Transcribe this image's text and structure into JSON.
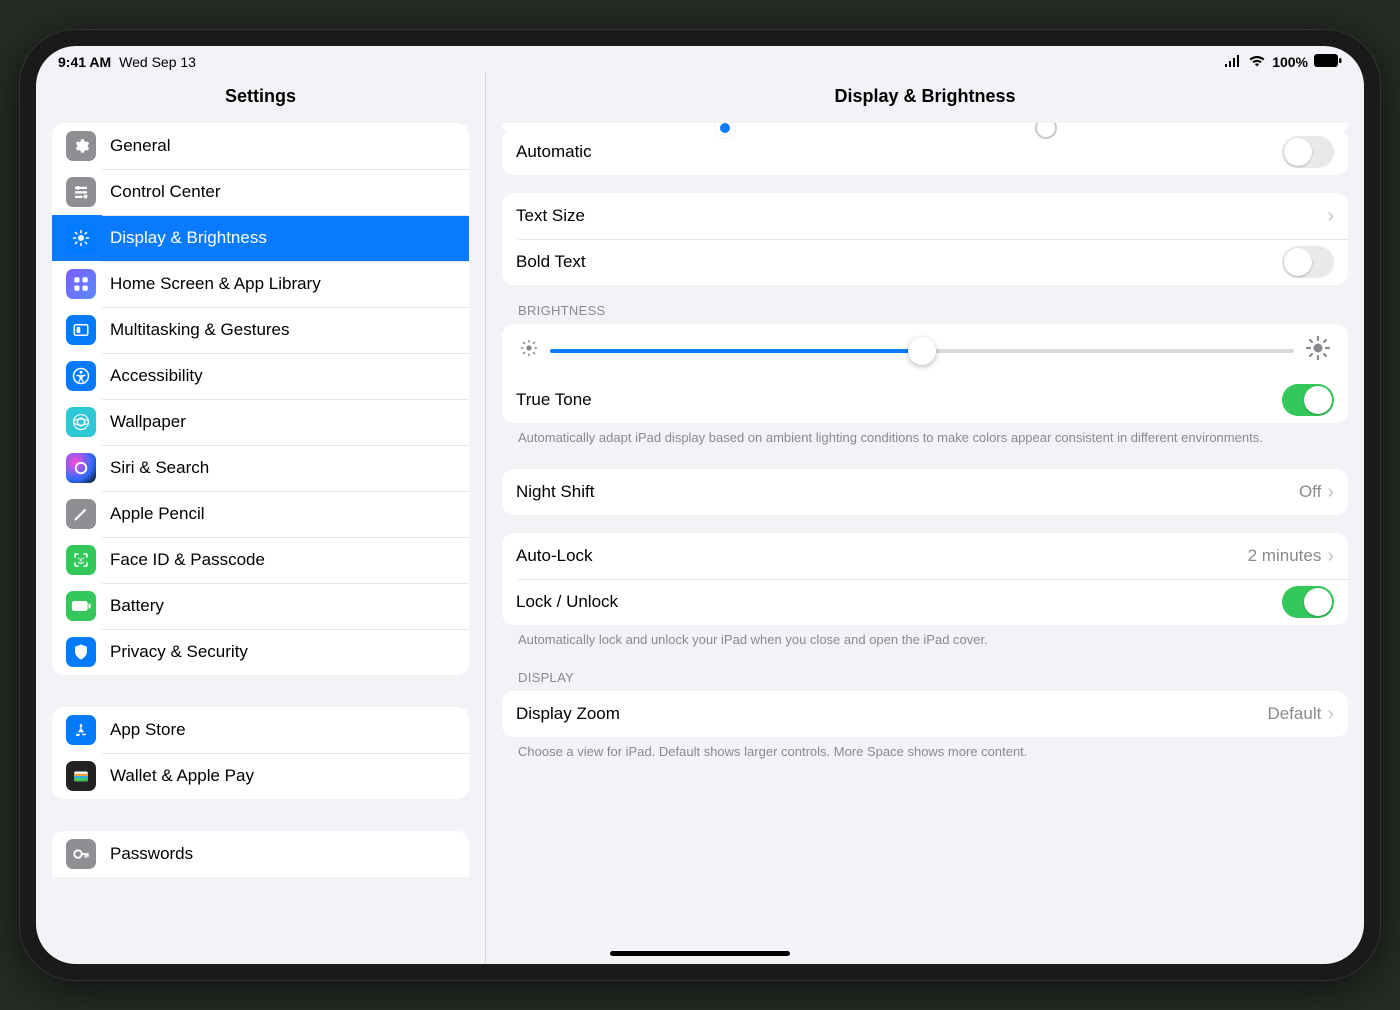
{
  "status": {
    "time": "9:41 AM",
    "date": "Wed Sep 13",
    "battery_pct": "100%"
  },
  "sidebar_title": "Settings",
  "detail_title": "Display & Brightness",
  "sidebar": {
    "group1": [
      {
        "key": "general",
        "label": "General",
        "iconColor": "bg-gray"
      },
      {
        "key": "control-center",
        "label": "Control Center",
        "iconColor": "bg-gray"
      },
      {
        "key": "display-brightness",
        "label": "Display & Brightness",
        "iconColor": "bg-blue",
        "selected": true
      },
      {
        "key": "home-screen",
        "label": "Home Screen & App Library",
        "iconColor": "bg-home"
      },
      {
        "key": "multitasking",
        "label": "Multitasking & Gestures",
        "iconColor": "bg-blue"
      },
      {
        "key": "accessibility",
        "label": "Accessibility",
        "iconColor": "bg-blue"
      },
      {
        "key": "wallpaper",
        "label": "Wallpaper",
        "iconColor": "bg-cyan"
      },
      {
        "key": "siri-search",
        "label": "Siri & Search",
        "iconColor": "bg-siri"
      },
      {
        "key": "apple-pencil",
        "label": "Apple Pencil",
        "iconColor": "bg-gray"
      },
      {
        "key": "faceid",
        "label": "Face ID & Passcode",
        "iconColor": "bg-green"
      },
      {
        "key": "battery",
        "label": "Battery",
        "iconColor": "bg-green"
      },
      {
        "key": "privacy",
        "label": "Privacy & Security",
        "iconColor": "bg-blue"
      }
    ],
    "group2": [
      {
        "key": "app-store",
        "label": "App Store",
        "iconColor": "bg-blue"
      },
      {
        "key": "wallet",
        "label": "Wallet & Apple Pay",
        "iconColor": "bg-dark"
      }
    ],
    "group3": [
      {
        "key": "passwords",
        "label": "Passwords",
        "iconColor": "bg-gray"
      }
    ]
  },
  "detail": {
    "automatic": {
      "label": "Automatic",
      "on": false
    },
    "text_size": {
      "label": "Text Size"
    },
    "bold_text": {
      "label": "Bold Text",
      "on": false
    },
    "brightness_header": "BRIGHTNESS",
    "brightness_pct": 50,
    "true_tone": {
      "label": "True Tone",
      "on": true
    },
    "true_tone_footer": "Automatically adapt iPad display based on ambient lighting conditions to make colors appear consistent in different environments.",
    "night_shift": {
      "label": "Night Shift",
      "value": "Off"
    },
    "auto_lock": {
      "label": "Auto-Lock",
      "value": "2 minutes"
    },
    "lock_unlock": {
      "label": "Lock / Unlock",
      "on": true
    },
    "lock_footer": "Automatically lock and unlock your iPad when you close and open the iPad cover.",
    "display_header": "DISPLAY",
    "display_zoom": {
      "label": "Display Zoom",
      "value": "Default"
    },
    "zoom_footer": "Choose a view for iPad. Default shows larger controls. More Space shows more content."
  }
}
